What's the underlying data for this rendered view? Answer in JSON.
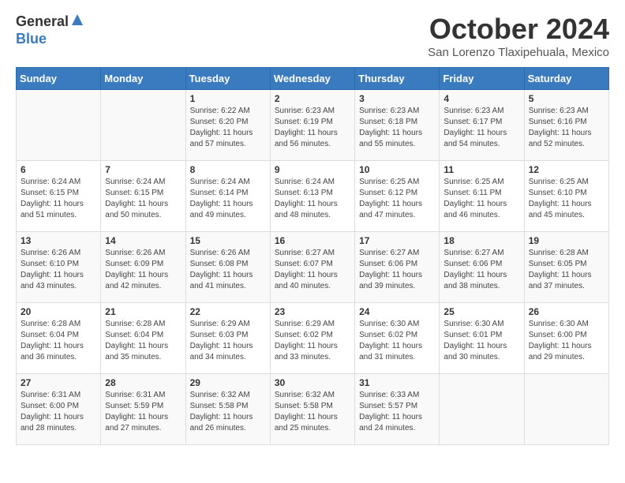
{
  "header": {
    "logo_general": "General",
    "logo_blue": "Blue",
    "month_title": "October 2024",
    "subtitle": "San Lorenzo Tlaxipehuala, Mexico"
  },
  "days_of_week": [
    "Sunday",
    "Monday",
    "Tuesday",
    "Wednesday",
    "Thursday",
    "Friday",
    "Saturday"
  ],
  "weeks": [
    [
      {
        "day": "",
        "info": ""
      },
      {
        "day": "",
        "info": ""
      },
      {
        "day": "1",
        "sunrise": "6:22 AM",
        "sunset": "6:20 PM",
        "daylight": "11 hours and 57 minutes."
      },
      {
        "day": "2",
        "sunrise": "6:23 AM",
        "sunset": "6:19 PM",
        "daylight": "11 hours and 56 minutes."
      },
      {
        "day": "3",
        "sunrise": "6:23 AM",
        "sunset": "6:18 PM",
        "daylight": "11 hours and 55 minutes."
      },
      {
        "day": "4",
        "sunrise": "6:23 AM",
        "sunset": "6:17 PM",
        "daylight": "11 hours and 54 minutes."
      },
      {
        "day": "5",
        "sunrise": "6:23 AM",
        "sunset": "6:16 PM",
        "daylight": "11 hours and 52 minutes."
      }
    ],
    [
      {
        "day": "6",
        "sunrise": "6:24 AM",
        "sunset": "6:15 PM",
        "daylight": "11 hours and 51 minutes."
      },
      {
        "day": "7",
        "sunrise": "6:24 AM",
        "sunset": "6:15 PM",
        "daylight": "11 hours and 50 minutes."
      },
      {
        "day": "8",
        "sunrise": "6:24 AM",
        "sunset": "6:14 PM",
        "daylight": "11 hours and 49 minutes."
      },
      {
        "day": "9",
        "sunrise": "6:24 AM",
        "sunset": "6:13 PM",
        "daylight": "11 hours and 48 minutes."
      },
      {
        "day": "10",
        "sunrise": "6:25 AM",
        "sunset": "6:12 PM",
        "daylight": "11 hours and 47 minutes."
      },
      {
        "day": "11",
        "sunrise": "6:25 AM",
        "sunset": "6:11 PM",
        "daylight": "11 hours and 46 minutes."
      },
      {
        "day": "12",
        "sunrise": "6:25 AM",
        "sunset": "6:10 PM",
        "daylight": "11 hours and 45 minutes."
      }
    ],
    [
      {
        "day": "13",
        "sunrise": "6:26 AM",
        "sunset": "6:10 PM",
        "daylight": "11 hours and 43 minutes."
      },
      {
        "day": "14",
        "sunrise": "6:26 AM",
        "sunset": "6:09 PM",
        "daylight": "11 hours and 42 minutes."
      },
      {
        "day": "15",
        "sunrise": "6:26 AM",
        "sunset": "6:08 PM",
        "daylight": "11 hours and 41 minutes."
      },
      {
        "day": "16",
        "sunrise": "6:27 AM",
        "sunset": "6:07 PM",
        "daylight": "11 hours and 40 minutes."
      },
      {
        "day": "17",
        "sunrise": "6:27 AM",
        "sunset": "6:06 PM",
        "daylight": "11 hours and 39 minutes."
      },
      {
        "day": "18",
        "sunrise": "6:27 AM",
        "sunset": "6:06 PM",
        "daylight": "11 hours and 38 minutes."
      },
      {
        "day": "19",
        "sunrise": "6:28 AM",
        "sunset": "6:05 PM",
        "daylight": "11 hours and 37 minutes."
      }
    ],
    [
      {
        "day": "20",
        "sunrise": "6:28 AM",
        "sunset": "6:04 PM",
        "daylight": "11 hours and 36 minutes."
      },
      {
        "day": "21",
        "sunrise": "6:28 AM",
        "sunset": "6:04 PM",
        "daylight": "11 hours and 35 minutes."
      },
      {
        "day": "22",
        "sunrise": "6:29 AM",
        "sunset": "6:03 PM",
        "daylight": "11 hours and 34 minutes."
      },
      {
        "day": "23",
        "sunrise": "6:29 AM",
        "sunset": "6:02 PM",
        "daylight": "11 hours and 33 minutes."
      },
      {
        "day": "24",
        "sunrise": "6:30 AM",
        "sunset": "6:02 PM",
        "daylight": "11 hours and 31 minutes."
      },
      {
        "day": "25",
        "sunrise": "6:30 AM",
        "sunset": "6:01 PM",
        "daylight": "11 hours and 30 minutes."
      },
      {
        "day": "26",
        "sunrise": "6:30 AM",
        "sunset": "6:00 PM",
        "daylight": "11 hours and 29 minutes."
      }
    ],
    [
      {
        "day": "27",
        "sunrise": "6:31 AM",
        "sunset": "6:00 PM",
        "daylight": "11 hours and 28 minutes."
      },
      {
        "day": "28",
        "sunrise": "6:31 AM",
        "sunset": "5:59 PM",
        "daylight": "11 hours and 27 minutes."
      },
      {
        "day": "29",
        "sunrise": "6:32 AM",
        "sunset": "5:58 PM",
        "daylight": "11 hours and 26 minutes."
      },
      {
        "day": "30",
        "sunrise": "6:32 AM",
        "sunset": "5:58 PM",
        "daylight": "11 hours and 25 minutes."
      },
      {
        "day": "31",
        "sunrise": "6:33 AM",
        "sunset": "5:57 PM",
        "daylight": "11 hours and 24 minutes."
      },
      {
        "day": "",
        "info": ""
      },
      {
        "day": "",
        "info": ""
      }
    ]
  ],
  "labels": {
    "sunrise": "Sunrise:",
    "sunset": "Sunset:",
    "daylight": "Daylight:"
  }
}
